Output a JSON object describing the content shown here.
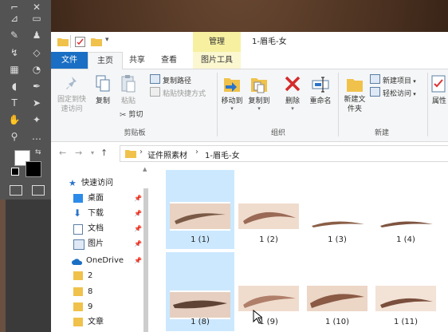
{
  "window": {
    "title": "1-眉毛-女",
    "context_tab": "管理",
    "qa_dropdown": "▾"
  },
  "tabs": {
    "file": "文件",
    "home": "主页",
    "share": "共享",
    "view": "查看",
    "picture_tools": "图片工具"
  },
  "ribbon": {
    "pin_quick_access": "固定到快速访问",
    "copy": "复制",
    "paste": "粘贴",
    "copy_path": "复制路径",
    "paste_shortcut": "粘贴快捷方式",
    "cut": "剪切",
    "clipboard_group": "剪贴板",
    "move_to": "移动到",
    "copy_to": "复制到",
    "delete": "删除",
    "rename": "重命名",
    "organize_group": "组织",
    "new_folder": "新建文件夹",
    "new_item": "新建项目",
    "easy_access": "轻松访问",
    "new_group": "新建",
    "properties": "属性"
  },
  "address": {
    "crumbs": [
      "证件照素材",
      "1-眉毛-女"
    ],
    "separator": "›"
  },
  "nav": {
    "quick_access": "快速访问",
    "items": [
      {
        "label": "桌面",
        "pinned": true
      },
      {
        "label": "下载",
        "pinned": true
      },
      {
        "label": "文档",
        "pinned": true
      },
      {
        "label": "图片",
        "pinned": true
      },
      {
        "label": "OneDrive",
        "pinned": true
      },
      {
        "label": "2",
        "pinned": false
      },
      {
        "label": "8",
        "pinned": false
      },
      {
        "label": "9",
        "pinned": false
      },
      {
        "label": "文章",
        "pinned": false
      }
    ]
  },
  "files": [
    {
      "name": "1 (1)",
      "selected": true
    },
    {
      "name": "1 (2)",
      "selected": false
    },
    {
      "name": "1 (3)",
      "selected": false
    },
    {
      "name": "1 (4)",
      "selected": false
    },
    {
      "name": "1 (8)",
      "selected": true
    },
    {
      "name": "1 (9)",
      "selected": false
    },
    {
      "name": "1 (10)",
      "selected": false
    },
    {
      "name": "1 (11)",
      "selected": false
    }
  ],
  "colors": {
    "file_tab": "#1a6fc4",
    "context_tab": "#f7f0a0",
    "selection": "#cce8ff",
    "folder": "#f0c24b"
  }
}
